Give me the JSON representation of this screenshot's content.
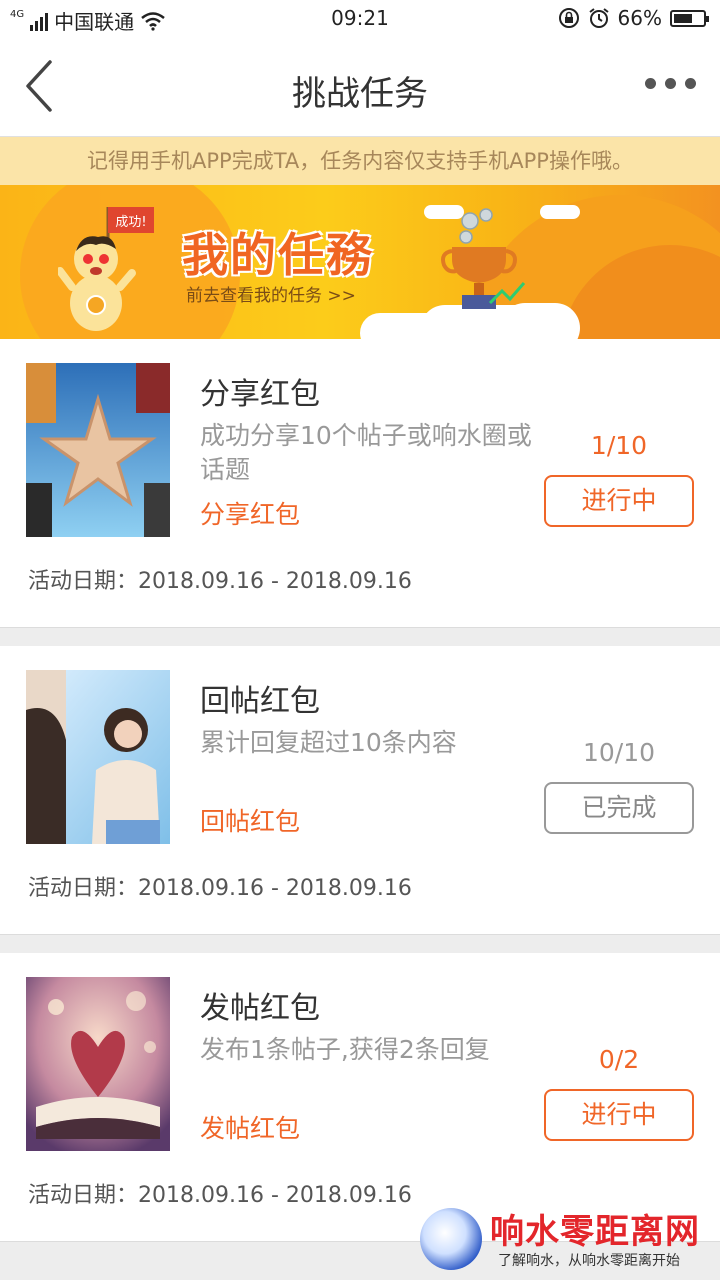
{
  "status_bar": {
    "network": "4G",
    "carrier": "中国联通",
    "time": "09:21",
    "battery": "66%",
    "battery_level": 0.66
  },
  "header": {
    "title": "挑战任务"
  },
  "notice": "记得用手机APP完成TA，任务内容仅支持手机APP操作哦。",
  "banner": {
    "flag_text": "成功!",
    "title": "我的任務",
    "subtitle": "前去查看我的任务 >>"
  },
  "tasks": [
    {
      "title": "分享红包",
      "description": "成功分享10个帖子或响水圈或话题",
      "tag": "分享红包",
      "progress": "1/10",
      "status": "进行中",
      "date": "活动日期：2018.09.16 - 2018.09.16"
    },
    {
      "title": "回帖红包",
      "description": "累计回复超过10条内容",
      "tag": "回帖红包",
      "progress": "10/10",
      "status": "已完成",
      "date": "活动日期：2018.09.16 - 2018.09.16"
    },
    {
      "title": "发帖红包",
      "description": "发布1条帖子,获得2条回复",
      "tag": "发帖红包",
      "progress": "0/2",
      "status": "进行中",
      "date": "活动日期：2018.09.16 - 2018.09.16"
    }
  ],
  "watermark": {
    "title": "响水零距离网",
    "subtitle": "了解响水，从响水零距离开始"
  },
  "colors": {
    "accent": "#f06628",
    "notice_bg": "#fbe4a8",
    "done": "#999999"
  }
}
